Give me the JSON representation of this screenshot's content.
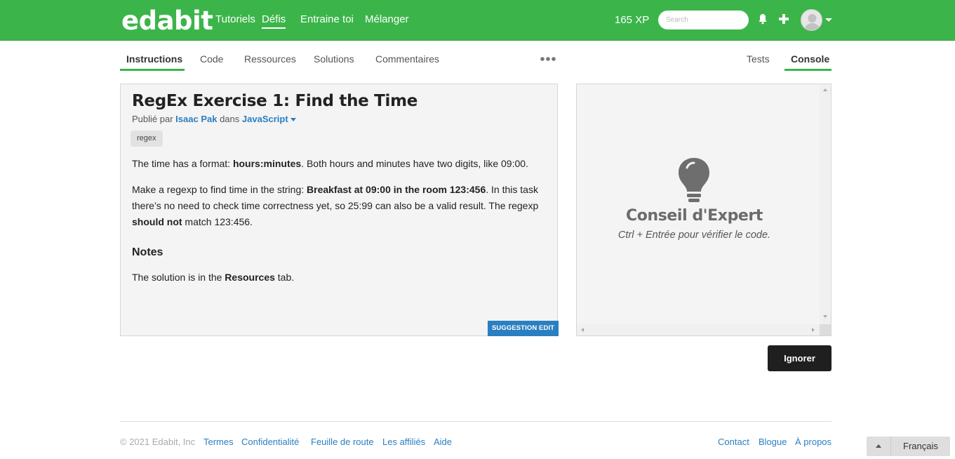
{
  "app": {
    "logo": "edabit"
  },
  "nav": {
    "items": [
      {
        "label": "Tutoriels"
      },
      {
        "label": "Défis",
        "active": true
      },
      {
        "label": "Entraine toi"
      },
      {
        "label": "Mélanger"
      }
    ],
    "xp": "165 XP",
    "search_placeholder": "Search"
  },
  "tabs": {
    "left": [
      "Instructions",
      "Code",
      "Ressources",
      "Solutions",
      "Commentaires"
    ],
    "right": [
      "Tests",
      "Console"
    ],
    "active_left": "Instructions",
    "active_right": "Console"
  },
  "challenge": {
    "title": "RegEx Exercise 1: Find the Time",
    "published_prefix": "Publié par",
    "author": "Isaac Pak",
    "in_word": "dans",
    "language": "JavaScript",
    "tag": "regex",
    "p1": {
      "a": "The time has a format: ",
      "b": "hours:minutes",
      "c": ". Both hours and minutes have two digits, like 09:00."
    },
    "p2": {
      "a": "Make a regexp to find time in the string: ",
      "b": "Breakfast at 09:00 in the room 123:456",
      "c": ". In this task there’s no need to check time correctness yet, so 25:99 can also be a valid result. The regexp ",
      "d": "should not",
      "e": " match 123:456."
    },
    "notes_heading": "Notes",
    "p3": {
      "a": "The solution is in the ",
      "b": "Resources",
      "c": " tab."
    },
    "suggestion_button": "SUGGESTION EDIT"
  },
  "console": {
    "icon": "lightbulb-icon",
    "heading": "Conseil d'Expert",
    "hint": "Ctrl + Entrée pour vérifier le code."
  },
  "ignore_button": "Ignorer",
  "footer": {
    "copyright": "© 2021 Edabit, Inc",
    "left_links": [
      "Termes",
      "Confidentialité",
      "Feuille de route",
      "Les affiliés",
      "Aide"
    ],
    "right_links": [
      "Contact",
      "Blogue",
      "À propos"
    ],
    "language": "Français"
  },
  "colors": {
    "brand": "#3bb54a",
    "link": "#2a7fc1",
    "dark_button": "#1f1f1f"
  }
}
